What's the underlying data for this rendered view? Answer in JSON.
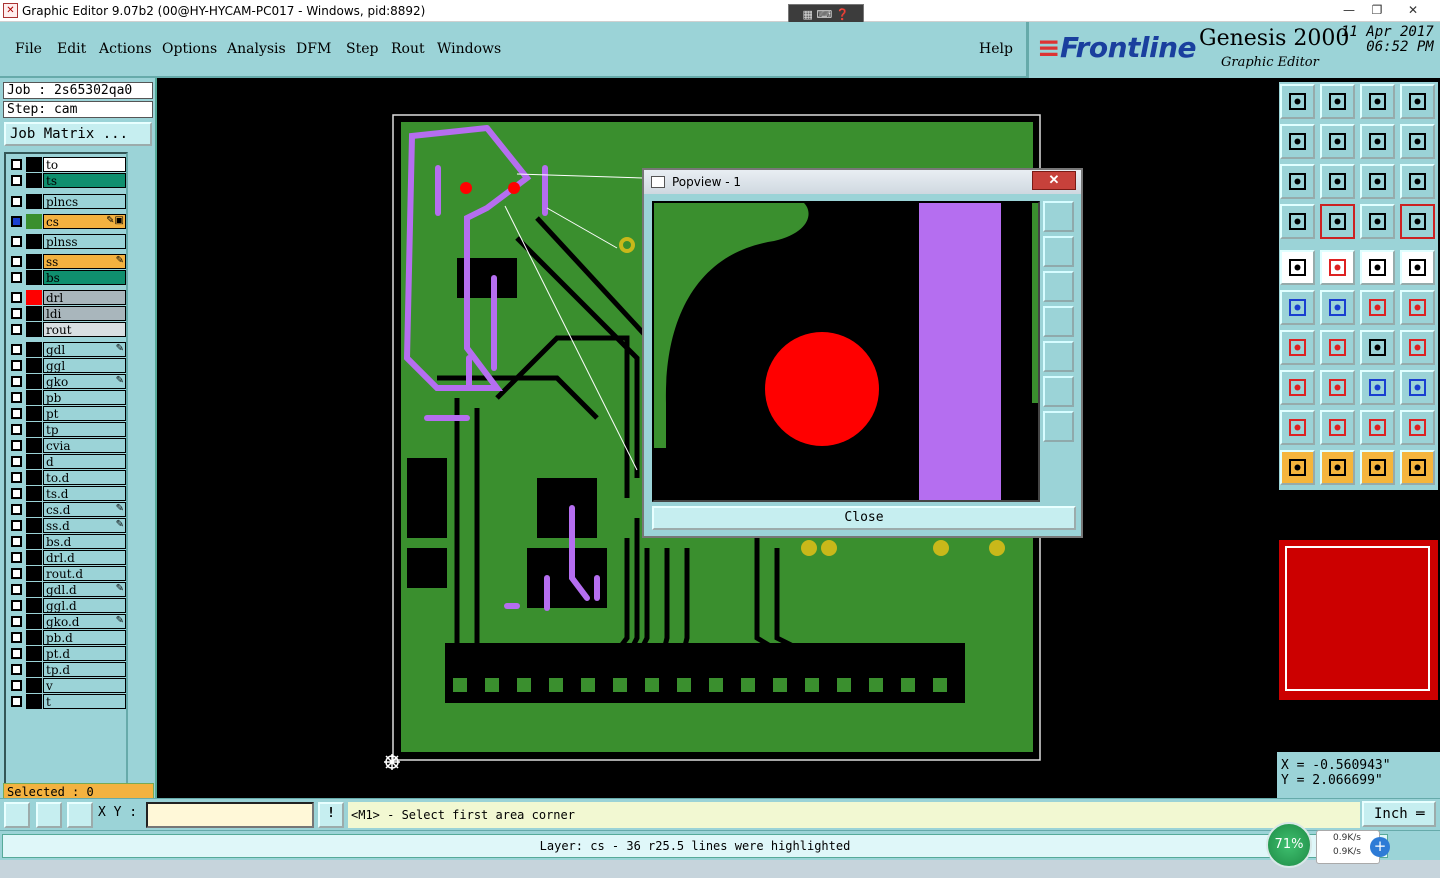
{
  "window": {
    "title": "Graphic Editor 9.07b2 (00@HY-HYCAM-PC017 - Windows, pid:8892)",
    "minimize": "—",
    "restore": "❐",
    "close": "✕",
    "ime": "▦ ⌨ ❓"
  },
  "menu": {
    "items": [
      {
        "label": "File"
      },
      {
        "label": "Edit"
      },
      {
        "label": "Actions"
      },
      {
        "label": "Options"
      },
      {
        "label": "Analysis"
      },
      {
        "label": "DFM"
      },
      {
        "label": "Step"
      },
      {
        "label": "Rout"
      },
      {
        "label": "Windows"
      }
    ],
    "help": "Help"
  },
  "brand": {
    "logo": "Frontline",
    "product": "Genesis 2000",
    "subtitle": "Graphic Editor",
    "date": "11 Apr 2017",
    "time": "06:52 PM"
  },
  "job": {
    "job_label": "Job : 2s65302qa0",
    "step_label": "Step: cam",
    "matrix_button": "Job Matrix ..."
  },
  "layers": [
    {
      "name": "to",
      "color": "#ffffff",
      "swatch": "#000000",
      "mark": ""
    },
    {
      "name": "ts",
      "color": "#0f8f6e",
      "swatch": "#000000",
      "mark": ""
    },
    {
      "name": "plncs",
      "color": "#9bd3d7",
      "swatch": "#000000",
      "mark": ""
    },
    {
      "name": "cs",
      "color": "#f3b240",
      "swatch": "#3a8f2e",
      "mark": "✎▣",
      "active": true
    },
    {
      "name": "plnss",
      "color": "#9bd3d7",
      "swatch": "#000000",
      "mark": ""
    },
    {
      "name": "ss",
      "color": "#f3b240",
      "swatch": "#000000",
      "mark": "✎"
    },
    {
      "name": "bs",
      "color": "#0f8f6e",
      "swatch": "#000000",
      "mark": ""
    },
    {
      "name": "drl",
      "color": "#a9b6bc",
      "swatch": "#ff0000",
      "mark": ""
    },
    {
      "name": "ldi",
      "color": "#a9b6bc",
      "swatch": "#000000",
      "mark": ""
    },
    {
      "name": "rout",
      "color": "#d9dfe2",
      "swatch": "#000000",
      "mark": ""
    },
    {
      "name": "gdl",
      "color": "#9bd3d7",
      "swatch": "#000000",
      "mark": "✎"
    },
    {
      "name": "ggl",
      "color": "#9bd3d7",
      "swatch": "#000000",
      "mark": ""
    },
    {
      "name": "gko",
      "color": "#9bd3d7",
      "swatch": "#000000",
      "mark": "✎"
    },
    {
      "name": "pb",
      "color": "#9bd3d7",
      "swatch": "#000000",
      "mark": ""
    },
    {
      "name": "pt",
      "color": "#9bd3d7",
      "swatch": "#000000",
      "mark": ""
    },
    {
      "name": "tp",
      "color": "#9bd3d7",
      "swatch": "#000000",
      "mark": ""
    },
    {
      "name": "cvia",
      "color": "#9bd3d7",
      "swatch": "#000000",
      "mark": ""
    },
    {
      "name": "d",
      "color": "#9bd3d7",
      "swatch": "#000000",
      "mark": ""
    },
    {
      "name": "to.d",
      "color": "#9bd3d7",
      "swatch": "#000000",
      "mark": ""
    },
    {
      "name": "ts.d",
      "color": "#9bd3d7",
      "swatch": "#000000",
      "mark": ""
    },
    {
      "name": "cs.d",
      "color": "#9bd3d7",
      "swatch": "#000000",
      "mark": "✎"
    },
    {
      "name": "ss.d",
      "color": "#9bd3d7",
      "swatch": "#000000",
      "mark": "✎"
    },
    {
      "name": "bs.d",
      "color": "#9bd3d7",
      "swatch": "#000000",
      "mark": ""
    },
    {
      "name": "drl.d",
      "color": "#9bd3d7",
      "swatch": "#000000",
      "mark": ""
    },
    {
      "name": "rout.d",
      "color": "#9bd3d7",
      "swatch": "#000000",
      "mark": ""
    },
    {
      "name": "gdl.d",
      "color": "#9bd3d7",
      "swatch": "#000000",
      "mark": "✎"
    },
    {
      "name": "ggl.d",
      "color": "#9bd3d7",
      "swatch": "#000000",
      "mark": ""
    },
    {
      "name": "gko.d",
      "color": "#9bd3d7",
      "swatch": "#000000",
      "mark": "✎"
    },
    {
      "name": "pb.d",
      "color": "#9bd3d7",
      "swatch": "#000000",
      "mark": ""
    },
    {
      "name": "pt.d",
      "color": "#9bd3d7",
      "swatch": "#000000",
      "mark": ""
    },
    {
      "name": "tp.d",
      "color": "#9bd3d7",
      "swatch": "#000000",
      "mark": ""
    },
    {
      "name": "v",
      "color": "#9bd3d7",
      "swatch": "#000000",
      "mark": ""
    },
    {
      "name": "t",
      "color": "#9bd3d7",
      "swatch": "#000000",
      "mark": ""
    }
  ],
  "selected": "Selected : 0",
  "popview": {
    "title": "Popview - 1",
    "close_x": "✕",
    "close_button": "Close"
  },
  "coords": {
    "x": "X = -0.560943\"",
    "y": "Y = 2.066699\""
  },
  "bottom": {
    "xy_label": "X Y :",
    "xy_value": "",
    "info_icon": "!",
    "prompt": "<M1> - Select first area corner",
    "units": "Inch ═"
  },
  "status": "Layer: cs - 36 r25.5 lines were highlighted",
  "network": {
    "percent": "71%",
    "up": "0.9K/s",
    "down": "0.9K/s",
    "plus": "+"
  },
  "colors": {
    "panel": "#9bd3d7",
    "copper": "#3a8f2e",
    "highlight": "#b56ef0",
    "drill": "#ff0000"
  },
  "icons": [
    "layer-up-icon",
    "layer-down-icon",
    "home-icon",
    "window-icon",
    "pan-left-icon",
    "pan-right-icon",
    "mirror-icon",
    "flip-icon",
    "zoom-fit-icon",
    "zoom-center-icon",
    "scale-1-2-icon",
    "help-icon",
    "measure-icon",
    "grid-icon",
    "snap-icon",
    "snap-red-icon",
    "pad-icon",
    "line-icon",
    "ruler-icon",
    "circle-icon",
    "net-icon",
    "cross-icon",
    "pad-line-icon",
    "pad-diag-icon",
    "angle-icon",
    "diagonal-icon",
    "arc-icon",
    "text-f-icon",
    "dim-icon",
    "split-icon",
    "bracket-icon",
    "shapes-icon",
    "triangle-icon",
    "triangle2-icon",
    "triangle3-icon",
    "triangle4-icon",
    "select-icon",
    "select-box-icon",
    "select-circle-icon",
    "route-icon"
  ]
}
